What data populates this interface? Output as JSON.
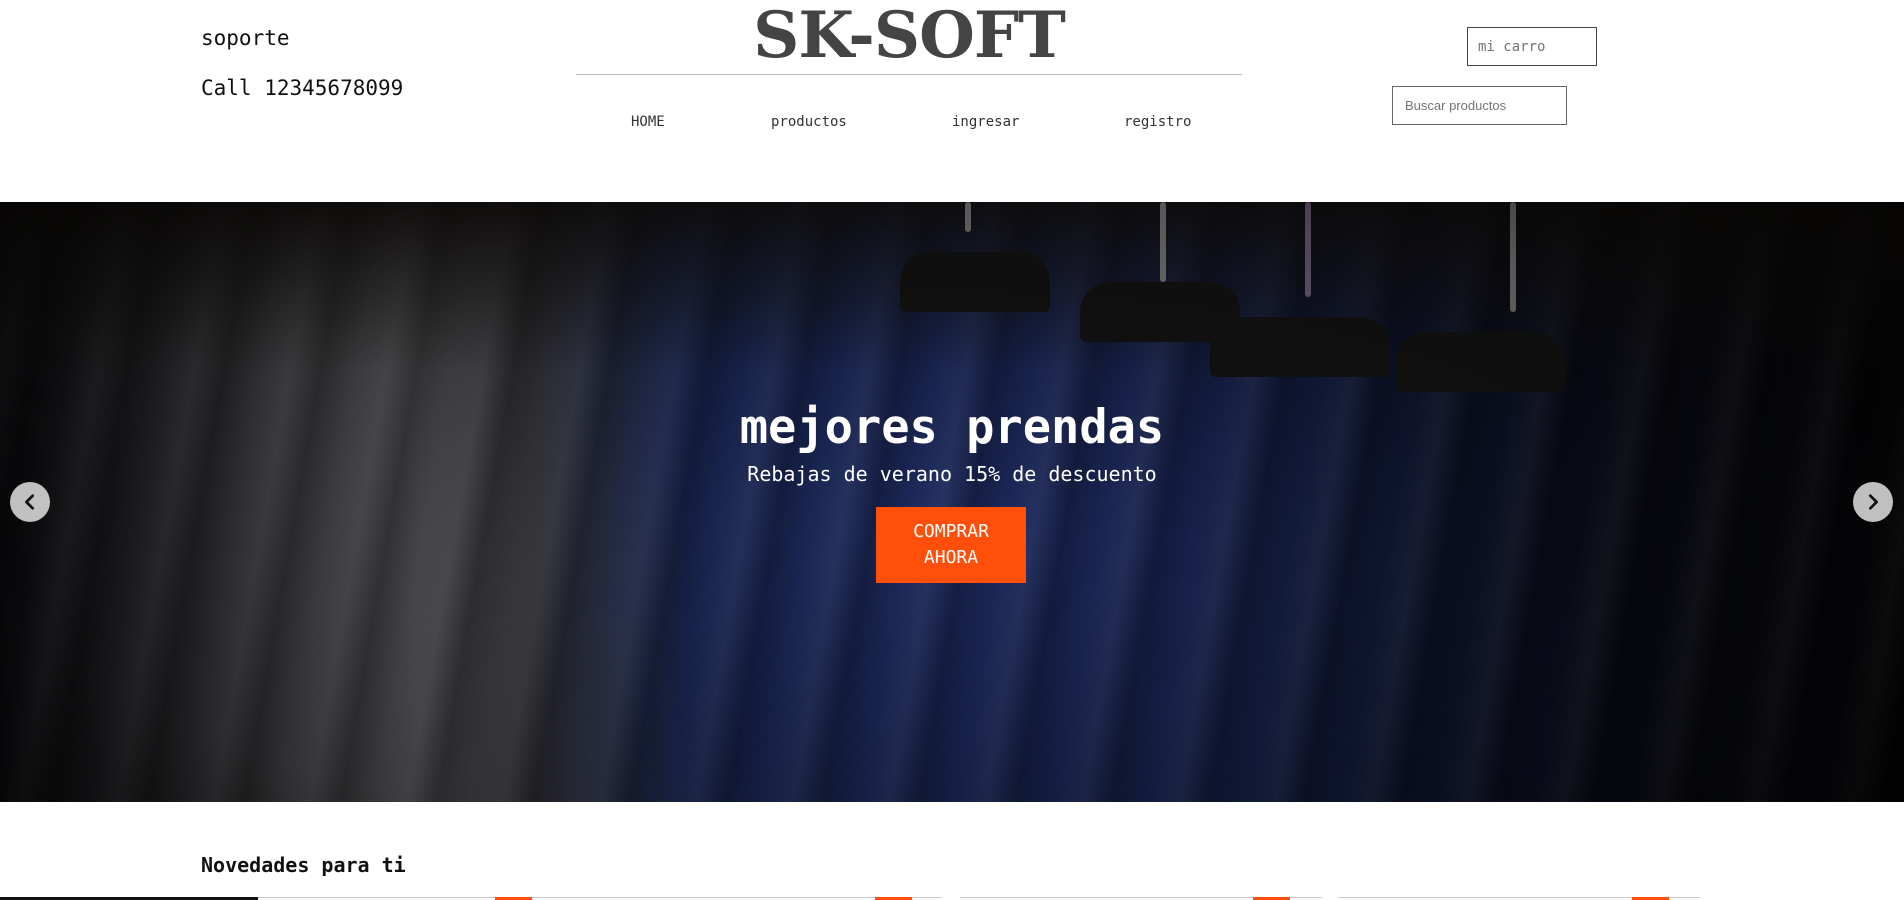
{
  "header": {
    "support_label": "soporte",
    "phone_label": "Call 12345678099",
    "logo": "SK-SOFT",
    "nav": [
      {
        "label": "HOME"
      },
      {
        "label": "productos"
      },
      {
        "label": "ingresar"
      },
      {
        "label": "registro"
      }
    ],
    "cart_placeholder": "mi carro",
    "search_placeholder": "Buscar productos"
  },
  "hero": {
    "title": "mejores prendas",
    "subtitle": "Rebajas de verano 15% de descuento",
    "cta_label": "COMPRAR AHORA",
    "prev_icon": "chevron-left-icon",
    "next_icon": "chevron-right-icon"
  },
  "section": {
    "title": "Novedades para ti"
  },
  "colors": {
    "accent": "#ff4f0a",
    "logo": "#444444",
    "text": "#111111"
  }
}
